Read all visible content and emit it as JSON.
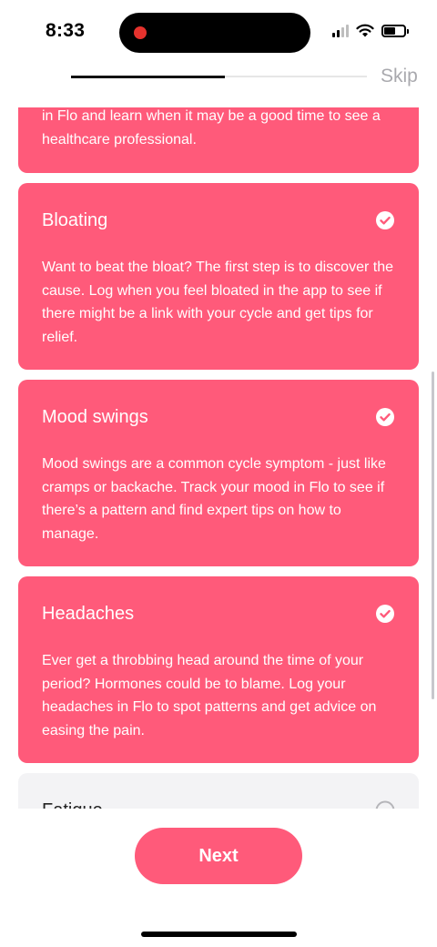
{
  "status_bar": {
    "time": "8:33"
  },
  "header": {
    "progress": 0.52,
    "skip_label": "Skip"
  },
  "cards": [
    {
      "title": "",
      "body": "in Flo and learn when it may be a good time to see a healthcare professional.",
      "selected": true
    },
    {
      "title": "Bloating",
      "body": "Want to beat the bloat? The first step is to discover the cause. Log when you feel bloated in the app to see if there might be a link with your cycle and get tips for relief.",
      "selected": true
    },
    {
      "title": "Mood swings",
      "body": "Mood swings are a common cycle symptom - just like cramps or backache. Track your mood in Flo to see if there’s a pattern and find expert tips on how to manage.",
      "selected": true
    },
    {
      "title": "Headaches",
      "body": "Ever get a throbbing head around the time of your period? Hormones could be to blame. Log your headaches in Flo to spot patterns and get advice on easing the pain.",
      "selected": true
    },
    {
      "title": "Fatigue",
      "body": "",
      "selected": false
    }
  ],
  "footer": {
    "next_label": "Next"
  },
  "colors": {
    "accent": "#ff5a7a",
    "unselected_card": "#f3f3f5"
  },
  "icons": {
    "selected": "check-circle-icon",
    "unselected": "empty-circle-icon"
  }
}
